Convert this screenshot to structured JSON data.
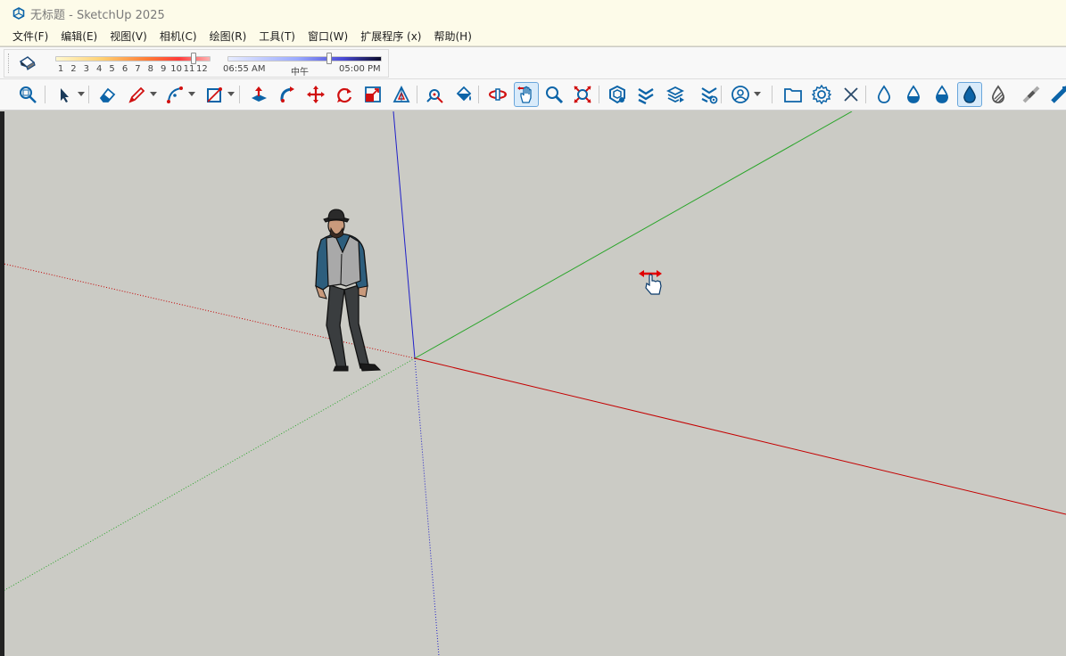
{
  "window": {
    "title": "无标题 - SketchUp 2025"
  },
  "menu": [
    {
      "id": "file",
      "label": "文件(F)"
    },
    {
      "id": "edit",
      "label": "编辑(E)"
    },
    {
      "id": "view",
      "label": "视图(V)"
    },
    {
      "id": "camera",
      "label": "相机(C)"
    },
    {
      "id": "draw",
      "label": "绘图(R)"
    },
    {
      "id": "tools",
      "label": "工具(T)"
    },
    {
      "id": "window",
      "label": "窗口(W)"
    },
    {
      "id": "extensions",
      "label": "扩展程序 (x)"
    },
    {
      "id": "help",
      "label": "帮助(H)"
    }
  ],
  "shadows": {
    "month_labels": [
      "1",
      "2",
      "3",
      "4",
      "5",
      "6",
      "7",
      "8",
      "9",
      "10",
      "11",
      "12"
    ],
    "month_value": 11,
    "time_start": "06:55 AM",
    "time_mid": "中午",
    "time_end": "05:00 PM",
    "time_fraction": 0.67
  },
  "toolbar": [
    {
      "id": "zoom-window",
      "icon": "zoom-window-icon"
    },
    {
      "id": "select",
      "icon": "arrow-cursor-icon",
      "dropdown": true
    },
    {
      "id": "eraser",
      "icon": "eraser-icon"
    },
    {
      "id": "line",
      "icon": "pencil-icon",
      "dropdown": true
    },
    {
      "id": "arc",
      "icon": "arc-icon",
      "dropdown": true
    },
    {
      "id": "rectangle",
      "icon": "rectangle-icon",
      "dropdown": true
    },
    {
      "id": "push-pull",
      "icon": "push-pull-icon"
    },
    {
      "id": "follow-me",
      "icon": "follow-me-icon"
    },
    {
      "id": "move",
      "icon": "move-icon"
    },
    {
      "id": "rotate",
      "icon": "rotate-icon"
    },
    {
      "id": "scale",
      "icon": "scale-icon"
    },
    {
      "id": "offset",
      "icon": "offset-icon"
    },
    {
      "id": "tape-measure",
      "icon": "tape-measure-icon"
    },
    {
      "id": "paint-bucket",
      "icon": "paint-bucket-icon"
    },
    {
      "id": "orbit",
      "icon": "orbit-icon"
    },
    {
      "id": "pan",
      "icon": "pan-hand-icon",
      "active": true
    },
    {
      "id": "zoom",
      "icon": "zoom-icon"
    },
    {
      "id": "zoom-extents",
      "icon": "zoom-extents-icon"
    },
    {
      "id": "warehouse",
      "icon": "warehouse-icon"
    },
    {
      "id": "extension-warehouse",
      "icon": "extension-warehouse-icon"
    },
    {
      "id": "layout-send",
      "icon": "send-to-layout-icon"
    },
    {
      "id": "extension-manager",
      "icon": "extension-manager-icon"
    },
    {
      "id": "account",
      "icon": "user-account-icon",
      "dropdown": true
    },
    {
      "id": "open-folder",
      "icon": "folder-icon"
    },
    {
      "id": "settings",
      "icon": "gear-icon"
    },
    {
      "id": "close",
      "icon": "close-icon"
    },
    {
      "id": "style-wireframe",
      "icon": "drop-outline-icon"
    },
    {
      "id": "style-hidden",
      "icon": "drop-half-icon"
    },
    {
      "id": "style-shaded",
      "icon": "drop-filled-icon"
    },
    {
      "id": "style-textured",
      "icon": "drop-textured-icon",
      "active": true
    },
    {
      "id": "style-monochrome",
      "icon": "drop-striped-icon"
    },
    {
      "id": "xray",
      "icon": "xray-icon"
    },
    {
      "id": "back-edges",
      "icon": "back-edges-icon"
    }
  ],
  "colors": {
    "accent_blue": "#0c64a8",
    "axis_red": "#c40000",
    "axis_green": "#2aa52a",
    "axis_blue": "#1010d0",
    "viewport_bg": "#cbcbc5",
    "menu_bg": "#fdfbe9"
  },
  "cursor": {
    "icon": "pan-hand-cursor-icon"
  }
}
